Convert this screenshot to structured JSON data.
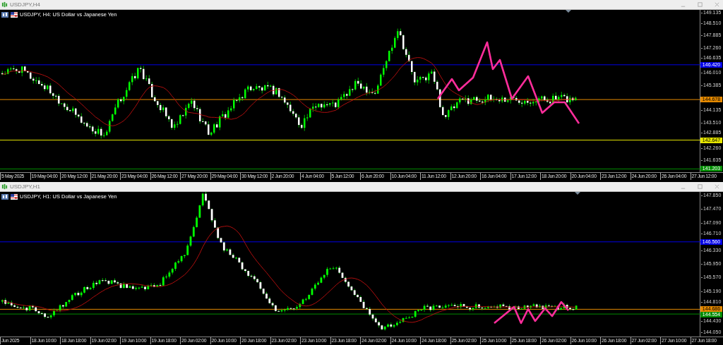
{
  "charts": [
    {
      "window_title": "USDJPY,H4",
      "header": "USDJPY, H4: US Dollar vs Japanese Yen",
      "price_ticks": [
        "149.135",
        "148.510",
        "147.885",
        "147.260",
        "146.635",
        "146.010",
        "145.385",
        "144.135",
        "143.510",
        "142.885",
        "142.260",
        "141.635"
      ],
      "levels": [
        {
          "price": "146.420",
          "color": "#0000e6"
        },
        {
          "price": "144.678",
          "color": "#e68a00"
        },
        {
          "price": "142.647",
          "color": "#e6e600"
        },
        {
          "price": "141.203",
          "color": "#008c00"
        }
      ],
      "time_labels": [
        "5 May 2025",
        "19 May 04:00",
        "20 May 12:00",
        "21 May 20:00",
        "23 May 04:00",
        "26 May 12:00",
        "27 May 20:00",
        "29 May 04:00",
        "30 May 12:00",
        "2 Jun 20:00",
        "4 Jun 04:00",
        "5 Jun 12:00",
        "6 Jun 20:00",
        "10 Jun 04:00",
        "11 Jun 12:00",
        "12 Jun 20:00",
        "16 Jun 04:00",
        "17 Jun 12:00",
        "18 Jun 20:00",
        "20 Jun 04:00",
        "23 Jun 12:00",
        "24 Jun 20:00",
        "26 Jun 04:00",
        "27 Jun 12:00"
      ]
    },
    {
      "window_title": "USDJPY,H1",
      "header": "USDJPY, H1: US Dollar vs Japanese Yen",
      "price_ticks": [
        "147.850",
        "147.470",
        "147.090",
        "146.710",
        "146.330",
        "145.950",
        "145.570",
        "145.190",
        "144.810",
        "144.430",
        "144.050"
      ],
      "levels": [
        {
          "price": "146.560",
          "color": "#0000e6"
        },
        {
          "price": "144.686",
          "color": "#e68a00"
        },
        {
          "price": "144.554",
          "color": "#008c00"
        }
      ],
      "time_labels": [
        "Jun 2025",
        "18 Jun 10:00",
        "18 Jun 18:00",
        "19 Jun 02:00",
        "19 Jun 10:00",
        "19 Jun 18:00",
        "20 Jun 02:00",
        "20 Jun 10:00",
        "20 Jun 18:00",
        "23 Jun 02:00",
        "23 Jun 10:00",
        "23 Jun 18:00",
        "24 Jun 02:00",
        "24 Jun 10:00",
        "24 Jun 18:00",
        "25 Jun 02:00",
        "25 Jun 10:00",
        "25 Jun 18:00",
        "26 Jun 02:00",
        "26 Jun 10:00",
        "26 Jun 18:00",
        "27 Jun 02:00",
        "27 Jun 10:00",
        "27 Jun 18:00"
      ]
    }
  ]
}
